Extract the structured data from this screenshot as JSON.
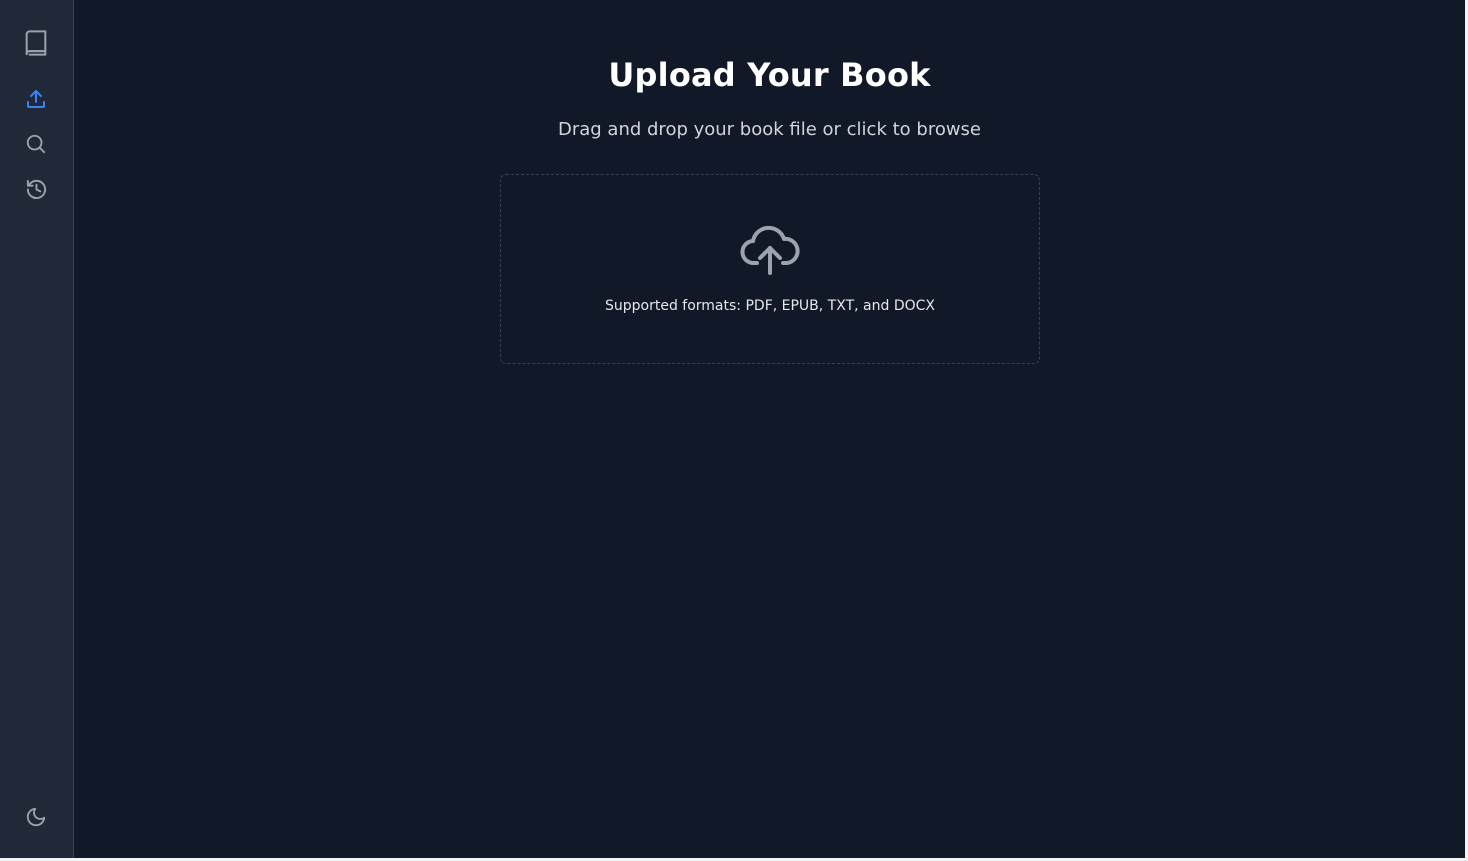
{
  "sidebar": {
    "items": [
      {
        "name": "Library",
        "icon": "book-icon",
        "active": false
      },
      {
        "name": "Upload",
        "icon": "upload-icon",
        "active": true
      },
      {
        "name": "Search",
        "icon": "search-icon",
        "active": false
      },
      {
        "name": "History",
        "icon": "history-icon",
        "active": false
      }
    ],
    "theme_toggle": {
      "icon": "moon-icon"
    }
  },
  "main": {
    "title": "Upload Your Book",
    "subtitle": "Drag and drop your book file or click to browse",
    "dropzone": {
      "icon": "cloud-upload-icon",
      "formats_text": "Supported formats: PDF, EPUB, TXT, and DOCX"
    }
  },
  "colors": {
    "background": "#111827",
    "sidebar": "#1f2937",
    "accent": "#3b82f6",
    "icon": "#9ca3af",
    "text": "#ffffff"
  }
}
